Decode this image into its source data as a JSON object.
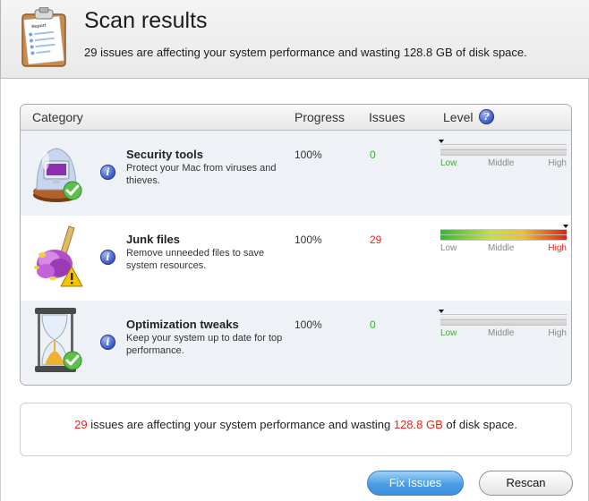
{
  "header": {
    "title": "Scan results",
    "subtitle": "29 issues are affecting your system performance and wasting 128.8 GB of disk space.",
    "icon": "clipboard-report-icon"
  },
  "table": {
    "columns": {
      "category": "Category",
      "progress": "Progress",
      "issues": "Issues",
      "level": "Level",
      "level_help_icon": "?"
    },
    "level_labels": {
      "low": "Low",
      "middle": "Middle",
      "high": "High"
    },
    "rows": [
      {
        "title": "Security tools",
        "description": "Protect your Mac from viruses and thieves.",
        "progress": "100%",
        "issues": "0",
        "level": 0,
        "active_level": "Low",
        "icon": "security-shield-icon",
        "status_icon": "checkmark-badge-icon",
        "info_icon": "i"
      },
      {
        "title": "Junk files",
        "description": "Remove unneeded files to save system resources.",
        "progress": "100%",
        "issues": "29",
        "level": 1,
        "active_level": "High",
        "icon": "duster-icon",
        "status_icon": "warning-triangle-icon",
        "info_icon": "i"
      },
      {
        "title": "Optimization tweaks",
        "description": "Keep your system up to date for top performance.",
        "progress": "100%",
        "issues": "0",
        "level": 0,
        "active_level": "Low",
        "icon": "hourglass-icon",
        "status_icon": "checkmark-badge-icon",
        "info_icon": "i"
      }
    ]
  },
  "summary": {
    "count": "29",
    "text_1": " issues are affecting your system performance and wasting ",
    "size": "128.8 GB",
    "text_2": " of disk space."
  },
  "buttons": {
    "fix_label": "Fix Issues",
    "rescan_label": "Rescan"
  },
  "colors": {
    "ok": "#35b22d",
    "bad": "#e22a21",
    "accent": "#4a9de4"
  }
}
